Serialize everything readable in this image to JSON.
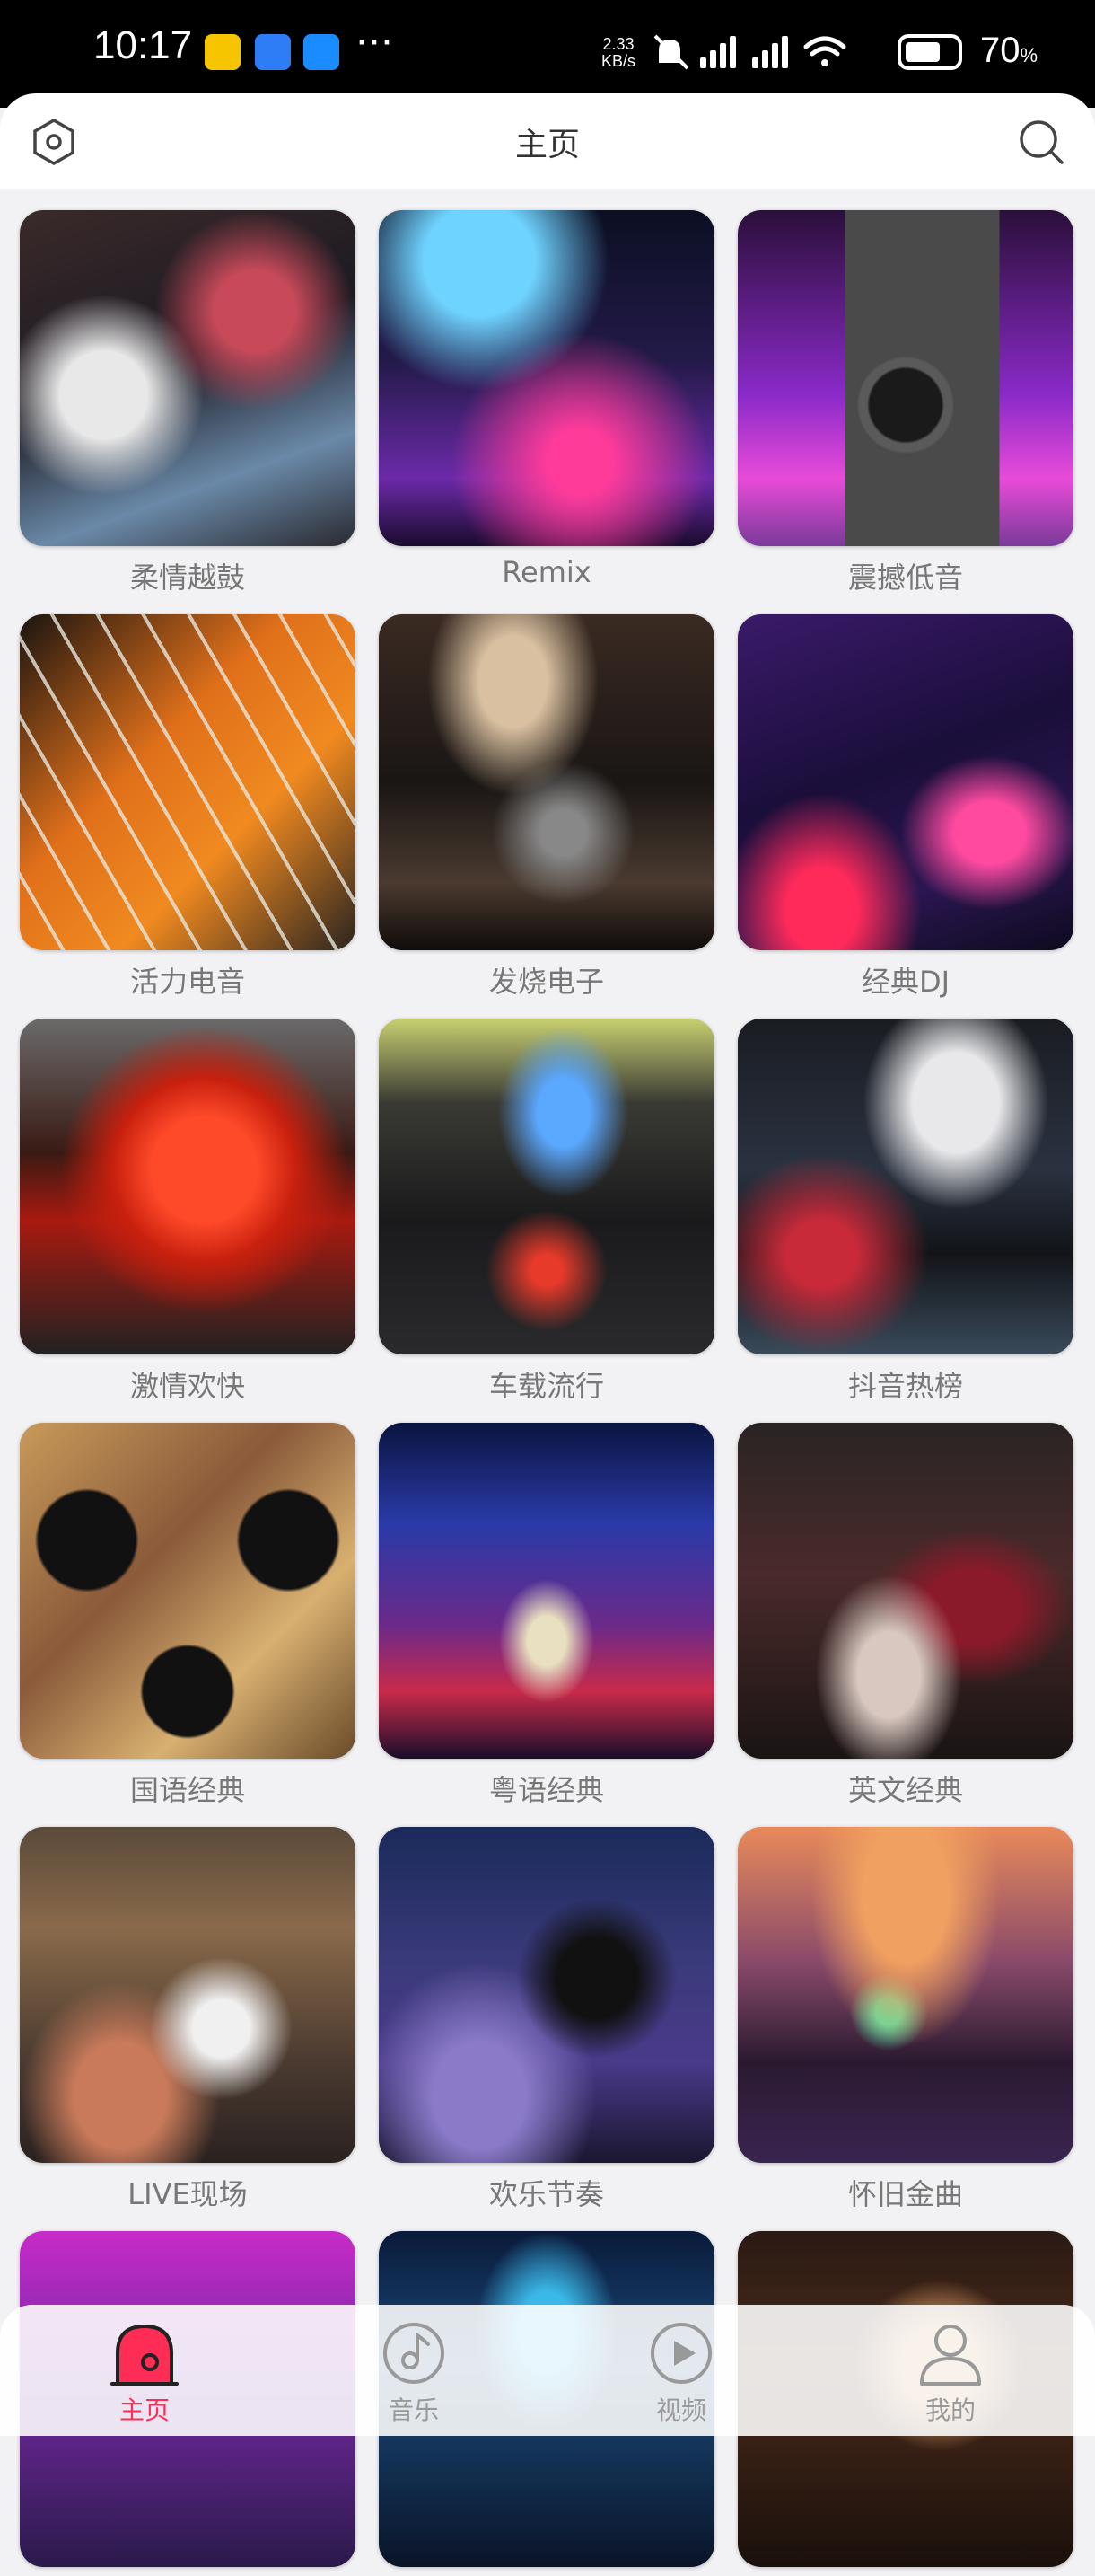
{
  "status_bar": {
    "time": "10:17",
    "net_speed_value": "2.33",
    "net_speed_unit": "KB/s",
    "more": "···",
    "battery_percent": "70",
    "battery_unit": "%",
    "battery_level": 0.7
  },
  "header": {
    "title": "主页",
    "left_icon": "settings-hexagon-icon",
    "right_icon": "search-icon"
  },
  "categories": [
    {
      "label": "柔情越鼓"
    },
    {
      "label": "Remix"
    },
    {
      "label": "震撼低音"
    },
    {
      "label": "活力电音"
    },
    {
      "label": "发烧电子"
    },
    {
      "label": "经典DJ"
    },
    {
      "label": "激情欢快"
    },
    {
      "label": "车载流行"
    },
    {
      "label": "抖音热榜"
    },
    {
      "label": "国语经典"
    },
    {
      "label": "粤语经典"
    },
    {
      "label": "英文经典"
    },
    {
      "label": "LIVE现场"
    },
    {
      "label": "欢乐节奏"
    },
    {
      "label": "怀旧金曲"
    },
    {
      "label": ""
    },
    {
      "label": ""
    },
    {
      "label": ""
    }
  ],
  "bottom_nav": [
    {
      "label": "主页",
      "icon": "home-icon",
      "active": true
    },
    {
      "label": "音乐",
      "icon": "music-note-icon",
      "active": false
    },
    {
      "label": "视频",
      "icon": "play-icon",
      "active": false
    },
    {
      "label": "我的",
      "icon": "profile-icon",
      "active": false
    }
  ]
}
